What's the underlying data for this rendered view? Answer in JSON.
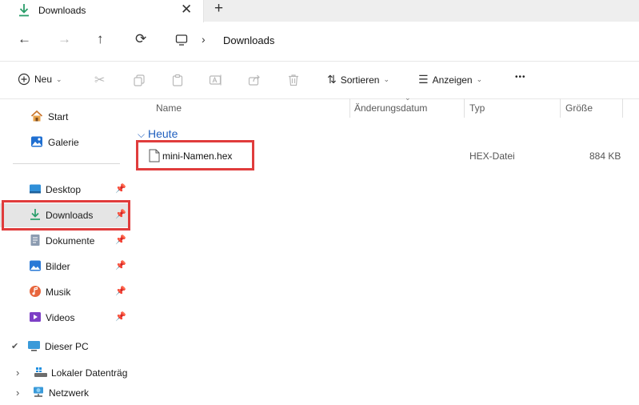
{
  "tab": {
    "title": "Downloads",
    "close_glyph": "✕",
    "new_tab_glyph": "+"
  },
  "nav": {
    "back_glyph": "←",
    "forward_glyph": "→",
    "up_glyph": "↑",
    "refresh_glyph": "⟳",
    "breadcrumb_sep": "›",
    "breadcrumb": "Downloads"
  },
  "commands": {
    "new_label": "Neu",
    "sort_label": "Sortieren",
    "view_label": "Anzeigen",
    "more_glyph": "•••"
  },
  "sidebar": {
    "items": [
      {
        "label": "Start",
        "icon": "home-icon"
      },
      {
        "label": "Galerie",
        "icon": "gallery-icon"
      },
      {
        "label": "Desktop",
        "icon": "desktop-icon",
        "pinned": true
      },
      {
        "label": "Downloads",
        "icon": "download-icon",
        "pinned": true,
        "selected": true
      },
      {
        "label": "Dokumente",
        "icon": "documents-icon",
        "pinned": true
      },
      {
        "label": "Bilder",
        "icon": "pictures-icon",
        "pinned": true
      },
      {
        "label": "Musik",
        "icon": "music-icon",
        "pinned": true
      },
      {
        "label": "Videos",
        "icon": "videos-icon",
        "pinned": true
      },
      {
        "label": "Dieser PC",
        "icon": "computer-icon",
        "expanded": true
      },
      {
        "label": "Lokaler Datenträg",
        "icon": "drive-icon"
      },
      {
        "label": "Netzwerk",
        "icon": "network-icon"
      }
    ]
  },
  "columns": {
    "name": "Name",
    "date": "Änderungsdatum",
    "type": "Typ",
    "size": "Größe"
  },
  "group": {
    "label": "Heute"
  },
  "files": [
    {
      "name": "mini-Namen.hex",
      "type": "HEX-Datei",
      "size": "884 KB"
    }
  ],
  "colors": {
    "accent": "#1f5fbf",
    "highlight": "#e03c3c",
    "download_green": "#2a9d6a"
  }
}
